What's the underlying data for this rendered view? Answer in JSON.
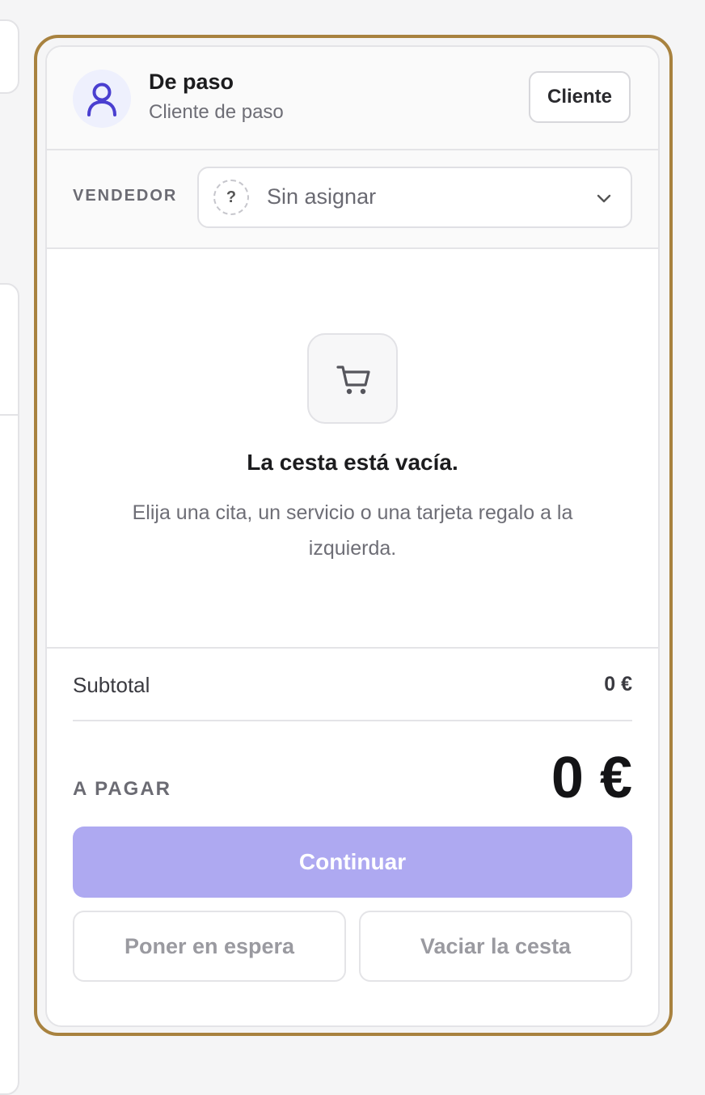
{
  "customer": {
    "name": "De paso",
    "subtitle": "Cliente de paso",
    "button_label": "Cliente",
    "avatar_icon": "user-icon"
  },
  "vendor": {
    "label": "VENDEDOR",
    "selected": "Sin asignar",
    "placeholder_icon": "question-mark-icon",
    "dropdown_icon": "chevron-down-icon"
  },
  "cart": {
    "icon": "cart-icon",
    "empty_title": "La cesta está vacía.",
    "empty_description": "Elija una cita, un servicio o una tarjeta regalo a la izquierda."
  },
  "summary": {
    "subtotal_label": "Subtotal",
    "subtotal_value": "0 €",
    "to_pay_label": "A PAGAR",
    "to_pay_value": "0 €"
  },
  "actions": {
    "continue_label": "Continuar",
    "hold_label": "Poner en espera",
    "clear_label": "Vaciar la cesta"
  },
  "colors": {
    "frame_accent": "#a8823f",
    "primary_button": "#aea9f1",
    "avatar_icon": "#4a3fd0",
    "avatar_bg": "#eef0fd"
  }
}
